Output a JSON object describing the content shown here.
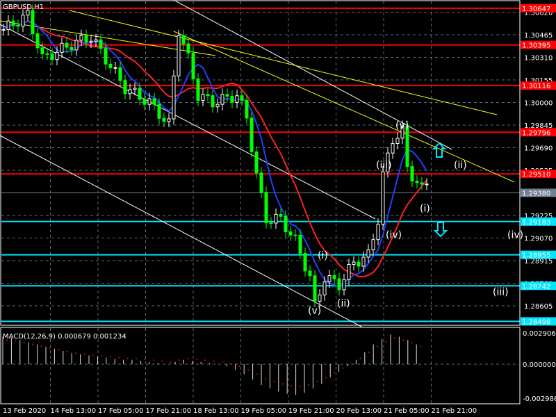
{
  "header": {
    "symbol": "GBPUSD,H1"
  },
  "macd": {
    "label": "MACD(12,26,9) 0.000679 0.001234",
    "axis_ticks": [
      "0.002906",
      "0.000000",
      "-0.002986"
    ]
  },
  "colors": {
    "background": "#000000",
    "grid": "#5a6a7a",
    "resistance": "#ff0000",
    "support": "#00e5ff",
    "bid": "#708090",
    "trend": "#ffff00",
    "channel": "#ffffff",
    "candle_up": "#ffffff",
    "candle_down": "#00ff00",
    "ma_red": "#ff2020",
    "ma_blue": "#2040ff"
  },
  "chart_data": {
    "type": "candlestick",
    "title": "GBPUSD,H1",
    "price_axis_ticks": [
      "1.30620",
      "1.30465",
      "1.30310",
      "1.30155",
      "1.30000",
      "1.29845",
      "1.29690",
      "1.29535",
      "1.29380",
      "1.29225",
      "1.29070",
      "1.28915",
      "1.28760",
      "1.28605"
    ],
    "time_axis_ticks": [
      "13 Feb 2020",
      "14 Feb 13:00",
      "17 Feb 05:00",
      "17 Feb 21:00",
      "18 Feb 13:00",
      "19 Feb 05:00",
      "19 Feb 21:00",
      "20 Feb 13:00",
      "21 Feb 05:00",
      "21 Feb 21:00"
    ],
    "ylim": [
      1.2846,
      1.307
    ],
    "resistance_levels": [
      "1.30647",
      "1.30395",
      "1.30116",
      "1.29796",
      "1.29510"
    ],
    "support_levels": [
      "1.29183",
      "1.28955",
      "1.28742",
      "1.28498"
    ],
    "bid": "1.29380",
    "close_path": [
      [
        0,
        1.305
      ],
      [
        5,
        1.306
      ],
      [
        8,
        1.303
      ],
      [
        14,
        1.304
      ],
      [
        18,
        1.3045
      ],
      [
        21,
        1.303
      ],
      [
        25,
        1.301
      ],
      [
        30,
        1.3
      ],
      [
        34,
        1.2985
      ],
      [
        36,
        1.305
      ],
      [
        38,
        1.303
      ],
      [
        40,
        1.3005
      ],
      [
        43,
        1.3
      ],
      [
        48,
        1.3005
      ],
      [
        50,
        1.299
      ],
      [
        52,
        1.295
      ],
      [
        54,
        1.292
      ],
      [
        57,
        1.292
      ],
      [
        60,
        1.2905
      ],
      [
        63,
        1.288
      ],
      [
        64,
        1.286
      ],
      [
        66,
        1.288
      ],
      [
        69,
        1.2875
      ],
      [
        72,
        1.289
      ],
      [
        75,
        1.2895
      ],
      [
        77,
        1.292
      ],
      [
        78,
        1.295
      ],
      [
        80,
        1.2975
      ],
      [
        82,
        1.298
      ],
      [
        83,
        1.2955
      ],
      [
        86,
        1.294
      ],
      [
        87,
        1.2945
      ]
    ],
    "macd_histogram": [
      0.0025,
      0.0024,
      0.0022,
      0.002,
      0.0018,
      0.0016,
      0.0014,
      0.0012,
      0.001,
      0.0009,
      0.0008,
      0.0007,
      0.0006,
      0.0005,
      0.0004,
      0.0004,
      0.0003,
      0.0002,
      0.0001,
      0.0,
      0.0002,
      0.0004,
      0.0003,
      0.0002,
      0.0001,
      0.0,
      -0.0002,
      -0.0005,
      -0.0009,
      -0.0014,
      -0.0019,
      -0.0022,
      -0.0025,
      -0.0027,
      -0.0028,
      -0.0026,
      -0.0022,
      -0.0018,
      -0.0012,
      -0.0007,
      -0.0002,
      0.0004,
      0.0011,
      0.0018,
      0.0023,
      0.0027,
      0.0025,
      0.0022,
      0.0018
    ],
    "wave_labels": [
      {
        "text": "(v)",
        "bar": 82,
        "price": 1.2982
      },
      {
        "text": "(ii)",
        "bar": 94,
        "price": 1.2955
      },
      {
        "text": "(iii)",
        "bar": 78,
        "price": 1.2955
      },
      {
        "text": "(i)",
        "bar": 87,
        "price": 1.2925
      },
      {
        "text": "(iv)",
        "bar": 80,
        "price": 1.2907
      },
      {
        "text": "(iv)",
        "bar": 105,
        "price": 1.2907
      },
      {
        "text": "(i)",
        "bar": 66,
        "price": 1.2893
      },
      {
        "text": "(ii)",
        "bar": 70,
        "price": 1.286
      },
      {
        "text": "(iii)",
        "bar": 102,
        "price": 1.2868
      },
      {
        "text": "(v)",
        "bar": 64,
        "price": 1.2855
      }
    ]
  }
}
